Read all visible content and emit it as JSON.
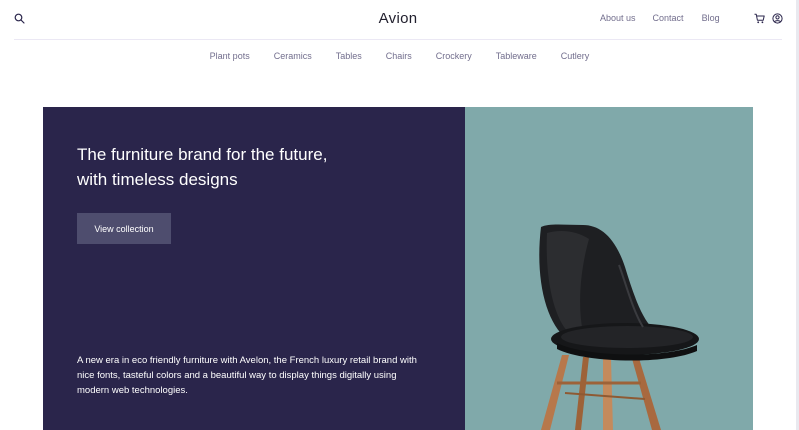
{
  "header": {
    "brand": "Avion",
    "links": [
      "About us",
      "Contact",
      "Blog"
    ],
    "icons": [
      "search-icon",
      "cart-icon",
      "user-icon"
    ]
  },
  "categories": [
    "Plant pots",
    "Ceramics",
    "Tables",
    "Chairs",
    "Crockery",
    "Tableware",
    "Cutlery"
  ],
  "hero": {
    "title": "The furniture brand for the future, with timeless designs",
    "button_label": "View collection",
    "description": "A new era in eco friendly furniture with Avelon, the French luxury retail brand with nice fonts, tasteful colors and a beautiful way to display things digitally using modern web technologies.",
    "image": "black-chair-with-wooden-legs"
  },
  "colors": {
    "brand_dark": "#2a254b",
    "button": "#4e4d6e",
    "image_background": "#80a9aa",
    "muted_text": "#726e8d"
  }
}
